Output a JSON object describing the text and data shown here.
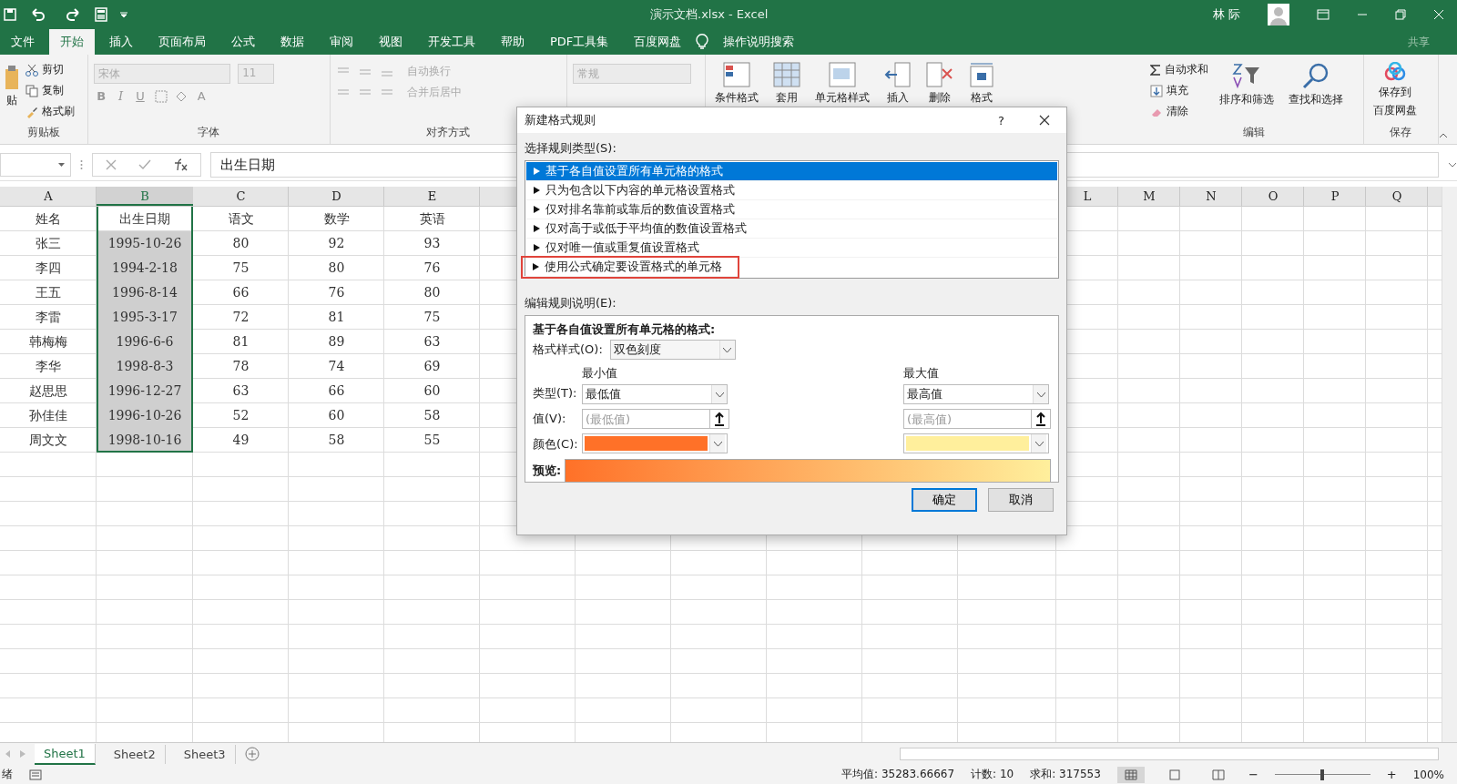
{
  "window": {
    "title": "演示文档.xlsx  -  Excel",
    "user": "林 际"
  },
  "tabs": [
    {
      "label": "文件",
      "selected": false
    },
    {
      "label": "开始",
      "selected": true
    },
    {
      "label": "插入",
      "selected": false
    },
    {
      "label": "页面布局",
      "selected": false
    },
    {
      "label": "公式",
      "selected": false
    },
    {
      "label": "数据",
      "selected": false
    },
    {
      "label": "审阅",
      "selected": false
    },
    {
      "label": "视图",
      "selected": false
    },
    {
      "label": "开发工具",
      "selected": false
    },
    {
      "label": "帮助",
      "selected": false
    },
    {
      "label": "PDF工具集",
      "selected": false
    },
    {
      "label": "百度网盘",
      "selected": false
    }
  ],
  "tell_me": "操作说明搜索",
  "share": "共享",
  "ribbon": {
    "clipboard": {
      "paste": "贴",
      "cut": "剪切",
      "copy": "复制",
      "painter": "格式刷",
      "group": "剪贴板"
    },
    "font": {
      "name": "宋体",
      "size": "11",
      "bold": "B",
      "italic": "I",
      "underline": "U",
      "font_color_letter": "A",
      "group": "字体"
    },
    "alignment": {
      "wrap": "自动换行",
      "merge": "合并后居中",
      "group": "对齐方式"
    },
    "number": {
      "format": "常规"
    },
    "styles": {
      "conditional": "条件格式",
      "table": "套用",
      "cell_styles": "单元格样式"
    },
    "cells": {
      "insert": "插入",
      "delete": "删除",
      "format": "格式"
    },
    "editing": {
      "autosum": "自动求和",
      "fill": "填充",
      "clear": "清除",
      "sort": "排序和筛选",
      "find": "查找和选择",
      "group": "编辑"
    },
    "save": {
      "lines": [
        "保存到",
        "百度网盘"
      ],
      "group": "保存"
    }
  },
  "formula_bar": {
    "content": "出生日期"
  },
  "sheet": {
    "columns": [
      {
        "label": "A",
        "selected": false
      },
      {
        "label": "B",
        "selected": true
      },
      {
        "label": "C",
        "selected": false
      },
      {
        "label": "D",
        "selected": false
      },
      {
        "label": "E",
        "selected": false
      }
    ],
    "right_columns": [
      {
        "label": "L"
      },
      {
        "label": "M"
      },
      {
        "label": "N"
      },
      {
        "label": "O"
      },
      {
        "label": "P"
      },
      {
        "label": "Q"
      }
    ],
    "rows": [
      [
        "姓名",
        "出生日期",
        "语文",
        "数学",
        "英语"
      ],
      [
        "张三",
        "1995-10-26",
        "80",
        "92",
        "93"
      ],
      [
        "李四",
        "1994-2-18",
        "75",
        "80",
        "76"
      ],
      [
        "王五",
        "1996-8-14",
        "66",
        "76",
        "80"
      ],
      [
        "李雷",
        "1995-3-17",
        "72",
        "81",
        "75"
      ],
      [
        "韩梅梅",
        "1996-6-6",
        "81",
        "89",
        "63"
      ],
      [
        "李华",
        "1998-8-3",
        "78",
        "74",
        "69"
      ],
      [
        "赵思思",
        "1996-12-27",
        "63",
        "66",
        "60"
      ],
      [
        "孙佳佳",
        "1996-10-26",
        "52",
        "60",
        "58"
      ],
      [
        "周文文",
        "1998-10-16",
        "49",
        "58",
        "55"
      ]
    ]
  },
  "sheet_tabs": [
    {
      "label": "Sheet1",
      "selected": true
    },
    {
      "label": "Sheet2",
      "selected": false
    },
    {
      "label": "Sheet3",
      "selected": false
    }
  ],
  "status_bar": {
    "mode": "绪",
    "average": "平均值: 35283.66667",
    "count": "计数: 10",
    "sum": "求和: 317553",
    "zoom": {
      "minus": "−",
      "plus": "+",
      "level": 0.5,
      "reading": "100%"
    }
  },
  "dialog": {
    "title": "新建格式规则",
    "help": "?",
    "rule_type_label": "选择规则类型(S):",
    "rule_types": [
      {
        "label": "基于各自值设置所有单元格的格式",
        "selected": true,
        "highlighted": false
      },
      {
        "label": "只为包含以下内容的单元格设置格式",
        "selected": false,
        "highlighted": false
      },
      {
        "label": "仅对排名靠前或靠后的数值设置格式",
        "selected": false,
        "highlighted": false
      },
      {
        "label": "仅对高于或低于平均值的数值设置格式",
        "selected": false,
        "highlighted": false
      },
      {
        "label": "仅对唯一值或重复值设置格式",
        "selected": false,
        "highlighted": false
      },
      {
        "label": "使用公式确定要设置格式的单元格",
        "selected": false,
        "highlighted": true
      }
    ],
    "edit_label": "编辑规则说明(E):",
    "description_title": "基于各自值设置所有单元格的格式:",
    "style_label": "格式样式(O):",
    "style_value": "双色刻度",
    "min": {
      "heading": "最小值",
      "type": "最低值",
      "value_placeholder": "(最低值)",
      "color": "#ff7128"
    },
    "max": {
      "heading": "最大值",
      "type": "最高值",
      "value_placeholder": "(最高值)",
      "color": "#ffef9c"
    },
    "type_label": "类型(T):",
    "value_label": "值(V):",
    "color_label": "颜色(C):",
    "preview_label": "预览:",
    "ok": "确定",
    "cancel": "取消"
  }
}
